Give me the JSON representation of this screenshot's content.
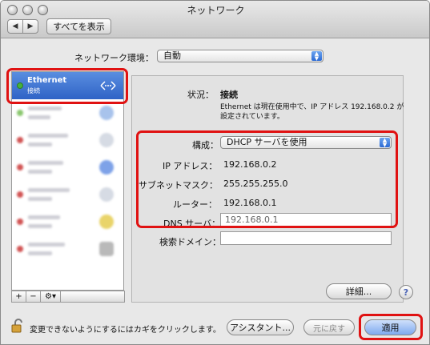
{
  "window": {
    "title": "ネットワーク",
    "show_all_label": "すべてを表示",
    "back_glyph": "◀",
    "forward_glyph": "▶"
  },
  "location": {
    "label": "ネットワーク環境：",
    "value": "自動"
  },
  "sidebar": {
    "items": [
      {
        "name": "Ethernet",
        "status": "接続",
        "dot_color": "#46b23b",
        "icon": "ethernet-arrows-icon",
        "selected": true
      },
      {
        "name": "",
        "status": "",
        "dot_color": "#8ac76e",
        "icon": "wifi-icon"
      },
      {
        "name": "",
        "status": "",
        "dot_color": "#d25454",
        "icon": "phone-icon"
      },
      {
        "name": "",
        "status": "",
        "dot_color": "#d25454",
        "icon": "bluetooth-icon"
      },
      {
        "name": "",
        "status": "",
        "dot_color": "#d25454",
        "icon": "phone-icon"
      },
      {
        "name": "",
        "status": "",
        "dot_color": "#d25454",
        "icon": "firewire-icon"
      },
      {
        "name": "",
        "status": "",
        "dot_color": "#d25454",
        "icon": "lock-icon"
      }
    ],
    "toolbar": {
      "add": "+",
      "remove": "−",
      "gear": "⚙▾"
    }
  },
  "detail": {
    "status_label": "状況：",
    "status_value": "接続",
    "status_desc_line1": "Ethernet は現在使用中で、IP アドレス 192.168.0.2 が",
    "status_desc_line2": "設定されています。",
    "config_label": "構成：",
    "config_value": "DHCP サーバを使用",
    "ip_label": "IP アドレス：",
    "ip_value": "192.168.0.2",
    "subnet_label": "サブネットマスク：",
    "subnet_value": "255.255.255.0",
    "router_label": "ルーター：",
    "router_value": "192.168.0.1",
    "dns_label": "DNS サーバ：",
    "dns_value": "192.168.0.1",
    "search_domain_label": "検索ドメイン：",
    "search_domain_value": "",
    "advanced_label": "詳細...",
    "help_label": "?"
  },
  "footer": {
    "lock_text": "変更できないようにするにはカギをクリックします。",
    "assistant_label": "アシスタント...",
    "revert_label": "元に戻す",
    "apply_label": "適用"
  },
  "colors": {
    "highlight": "#e01212",
    "selected_row": "#3b6fd0"
  }
}
